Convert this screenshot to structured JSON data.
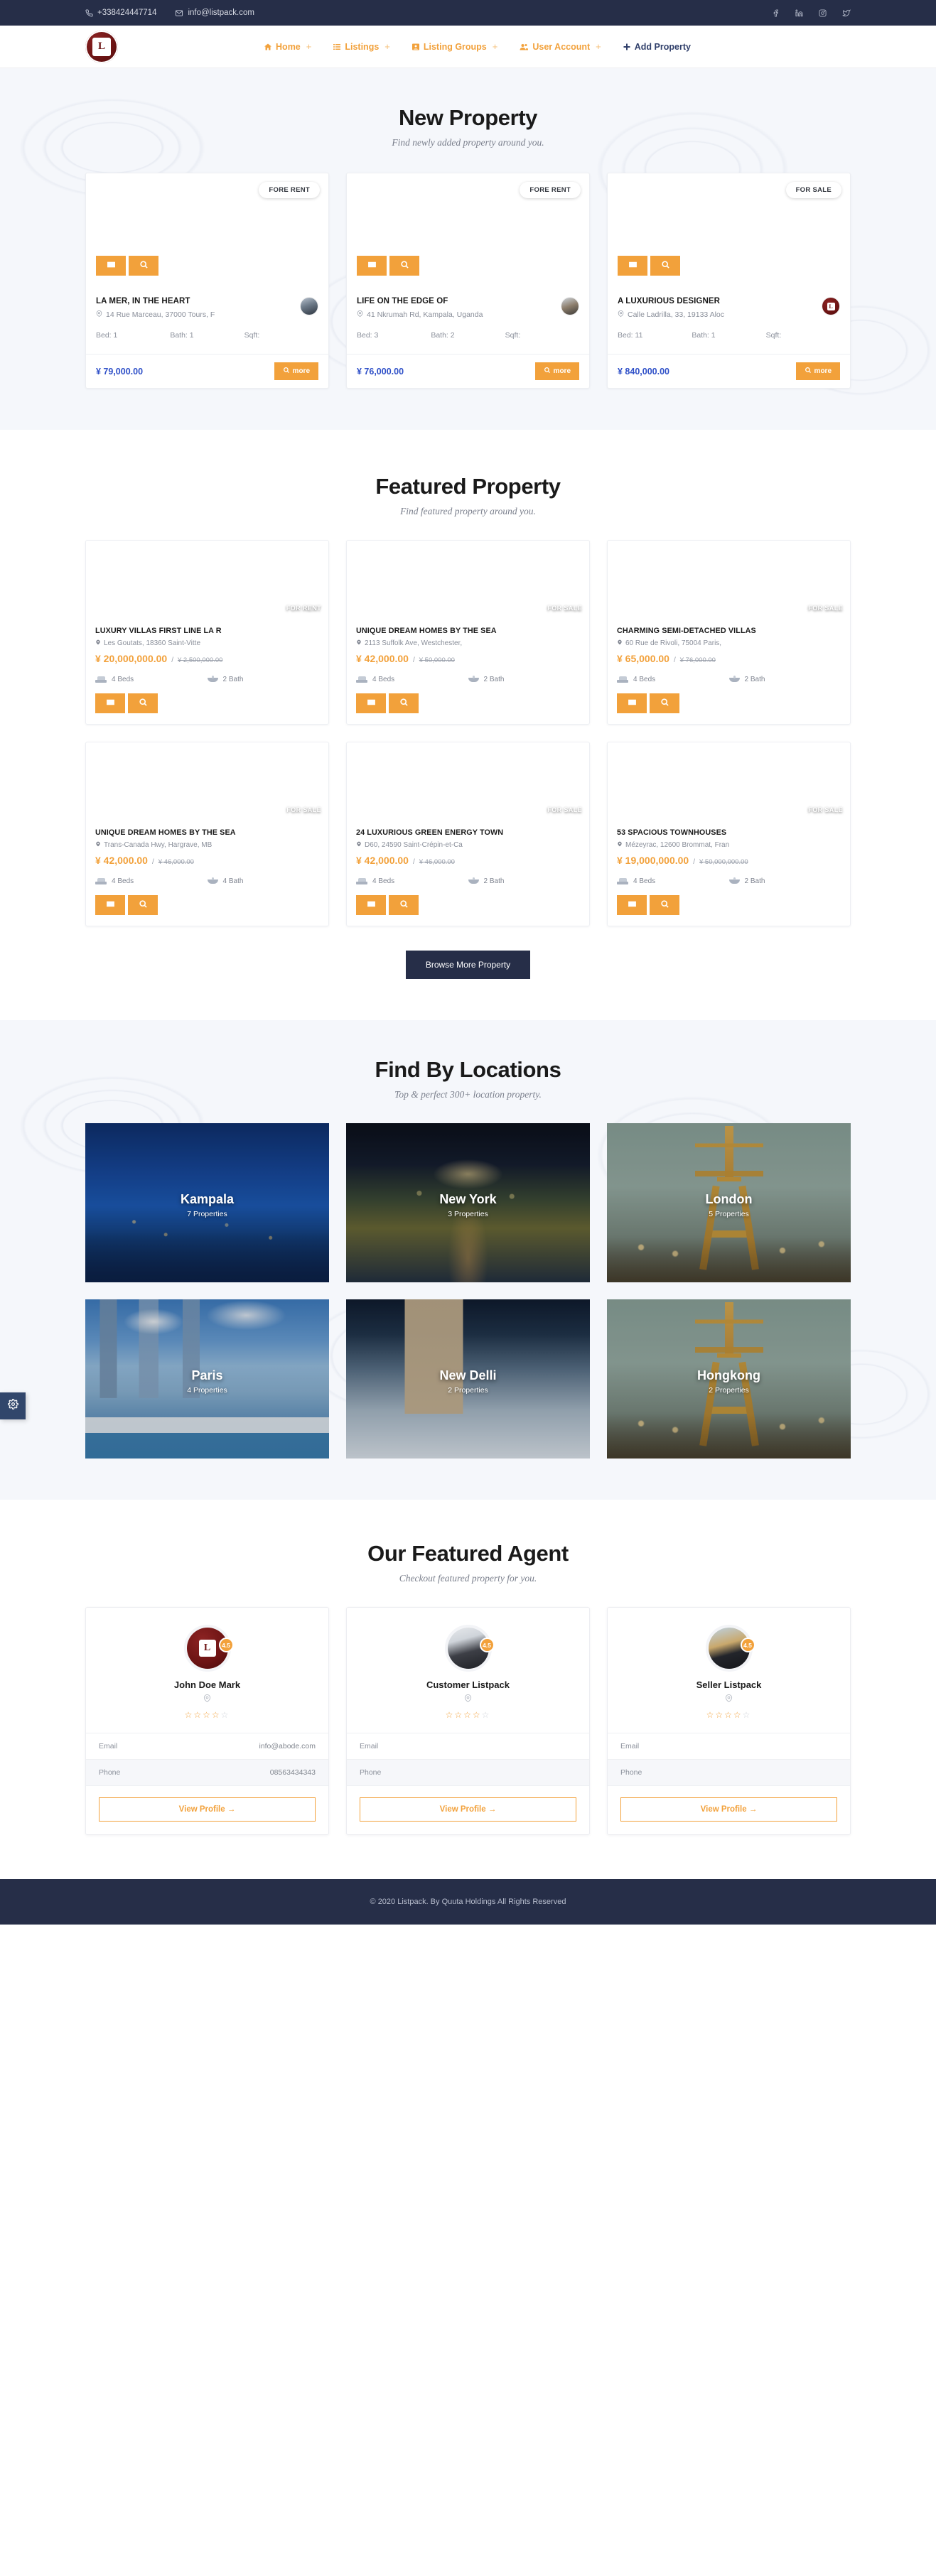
{
  "topbar": {
    "phone": "+338424447714",
    "email": "info@listpack.com",
    "socials": [
      "facebook-icon",
      "linkedin-icon",
      "instagram-icon",
      "twitter-icon"
    ]
  },
  "nav": {
    "logo_mark": "L",
    "items": [
      {
        "label": "Home",
        "icon": "home-icon",
        "has_plus": true
      },
      {
        "label": "Listings",
        "icon": "list-icon",
        "has_plus": true
      },
      {
        "label": "Listing Groups",
        "icon": "group-icon",
        "has_plus": true
      },
      {
        "label": "User Account",
        "icon": "users-icon",
        "has_plus": true
      },
      {
        "label": "Add Property",
        "icon": "plus-icon",
        "has_plus": false
      }
    ]
  },
  "new_property": {
    "title": "New Property",
    "subtitle": "Find newly added property around you.",
    "more_label": "more",
    "cards": [
      {
        "badge": "FORE RENT",
        "title": "LA MER, IN THE HEART",
        "address": "14 Rue Marceau, 37000 Tours, F",
        "bed_label": "Bed: 1",
        "bath_label": "Bath: 1",
        "sqft_label": "Sqft:",
        "price": "¥ 79,000.00",
        "avatar": "agent-photo"
      },
      {
        "badge": "FORE RENT",
        "title": "LIFE ON THE EDGE OF",
        "address": "41 Nkrumah Rd, Kampala, Uganda",
        "bed_label": "Bed: 3",
        "bath_label": "Bath: 2",
        "sqft_label": "Sqft:",
        "price": "¥ 76,000.00",
        "avatar": "agent-photo"
      },
      {
        "badge": "FOR SALE",
        "title": "A LUXURIOUS DESIGNER",
        "address": "Calle Ladrilla, 33, 19133 Aloc",
        "bed_label": "Bed: 11",
        "bath_label": "Bath: 1",
        "sqft_label": "Sqft:",
        "price": "¥ 840,000.00",
        "avatar": "site-logo"
      }
    ]
  },
  "featured_property": {
    "title": "Featured Property",
    "subtitle": "Find featured property around you.",
    "browse_label": "Browse More Property",
    "cards": [
      {
        "badge": "FOR RENT",
        "title": "LUXURY VILLAS FIRST LINE LA R",
        "address": "Les Goutats, 18360 Saint-Vitte",
        "price": "¥ 20,000,000.00",
        "old_price": "¥ 2,500,000.00",
        "beds": "4 Beds",
        "baths": "2 Bath"
      },
      {
        "badge": "FOR SALE",
        "title": "UNIQUE DREAM HOMES BY THE SEA",
        "address": "2113 Suffolk Ave, Westchester,",
        "price": "¥ 42,000.00",
        "old_price": "¥ 50,000.00",
        "beds": "4 Beds",
        "baths": "2 Bath"
      },
      {
        "badge": "FOR SALE",
        "title": "CHARMING SEMI-DETACHED VILLAS",
        "address": "60 Rue de Rivoli, 75004 Paris,",
        "price": "¥ 65,000.00",
        "old_price": "¥ 76,000.00",
        "beds": "4 Beds",
        "baths": "2 Bath"
      },
      {
        "badge": "FOR SALE",
        "title": "UNIQUE DREAM HOMES BY THE SEA",
        "address": "Trans-Canada Hwy, Hargrave, MB",
        "price": "¥ 42,000.00",
        "old_price": "¥ 46,000.00",
        "beds": "4 Beds",
        "baths": "4 Bath"
      },
      {
        "badge": "FOR SALE",
        "title": "24 LUXURIOUS GREEN ENERGY TOWN",
        "address": "D60, 24590 Saint-Crépin-et-Ca",
        "price": "¥ 42,000.00",
        "old_price": "¥ 46,000.00",
        "beds": "4 Beds",
        "baths": "2 Bath"
      },
      {
        "badge": "FOR SALE",
        "title": "53 SPACIOUS TOWNHOUSES",
        "address": "Mézeyrac, 12600 Brommat, Fran",
        "price": "¥ 19,000,000.00",
        "old_price": "¥ 50,000,000.00",
        "beds": "4 Beds",
        "baths": "2 Bath"
      }
    ]
  },
  "locations": {
    "title": "Find By Locations",
    "subtitle": "Top & perfect 300+ location property.",
    "cards": [
      {
        "name": "Kampala",
        "count": "7 Properties",
        "theme": "kampala"
      },
      {
        "name": "New York",
        "count": "3 Properties",
        "theme": "ny"
      },
      {
        "name": "London",
        "count": "5 Properties",
        "theme": "london"
      },
      {
        "name": "Paris",
        "count": "4 Properties",
        "theme": "paris"
      },
      {
        "name": "New Delli",
        "count": "2 Properties",
        "theme": "delhi"
      },
      {
        "name": "Hongkong",
        "count": "2 Properties",
        "theme": "hk"
      }
    ]
  },
  "agents": {
    "title": "Our Featured Agent",
    "subtitle": "Checkout featured property for you.",
    "email_label": "Email",
    "phone_label": "Phone",
    "profile_label": "View Profile →",
    "cards": [
      {
        "name": "John Doe Mark",
        "rating": "4.5",
        "stars_filled": 4,
        "email": "info@abode.com",
        "phone": "08563434343",
        "avatar": "site-logo"
      },
      {
        "name": "Customer Listpack",
        "rating": "4.5",
        "stars_filled": 4,
        "email": "",
        "phone": "",
        "avatar": "person-photo"
      },
      {
        "name": "Seller Listpack",
        "rating": "4.5",
        "stars_filled": 4,
        "email": "",
        "phone": "",
        "avatar": "person-photo"
      }
    ]
  },
  "footer": {
    "copyright": "© 2020 Listpack. By Quuta Holdings All Rights Reserved"
  },
  "settings_tab": {
    "icon": "gear-icon"
  },
  "colors": {
    "accent": "#f2a13b",
    "dark": "#262e48",
    "price_blue": "#2f50c8",
    "logo_red": "#6d1414"
  }
}
